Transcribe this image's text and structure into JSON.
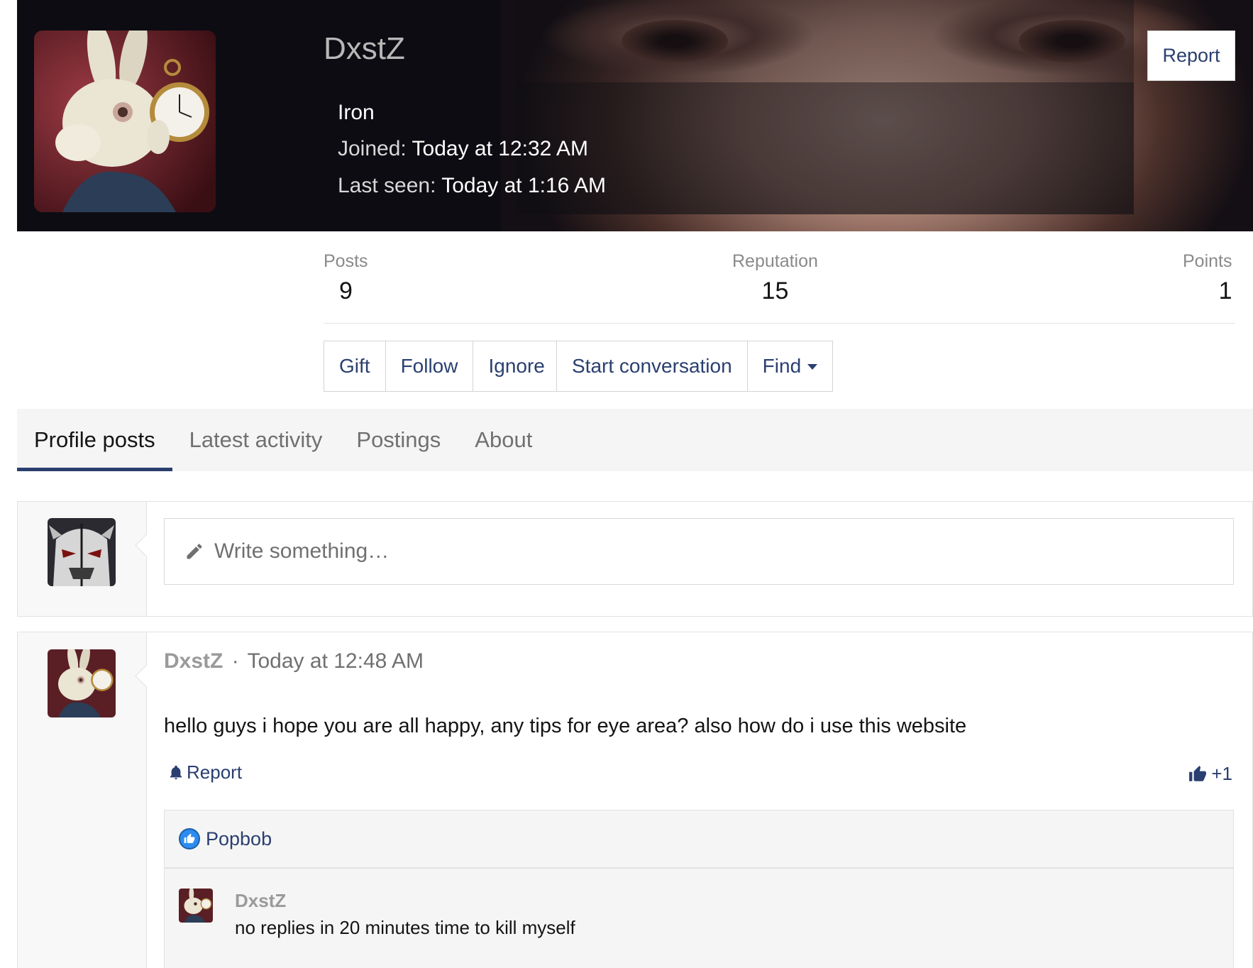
{
  "profile": {
    "username": "DxstZ",
    "user_title": "Iron",
    "joined_label": "Joined:",
    "joined_value": "Today at 12:32 AM",
    "last_seen_label": "Last seen:",
    "last_seen_value": "Today at 1:16 AM",
    "report_label": "Report"
  },
  "stats": {
    "posts_label": "Posts",
    "posts_value": "9",
    "reputation_label": "Reputation",
    "reputation_value": "15",
    "points_label": "Points",
    "points_value": "1"
  },
  "actions": {
    "gift": "Gift",
    "follow": "Follow",
    "ignore": "Ignore",
    "start_conversation": "Start conversation",
    "find": "Find"
  },
  "tabs": [
    {
      "label": "Profile posts",
      "active": true
    },
    {
      "label": "Latest activity",
      "active": false
    },
    {
      "label": "Postings",
      "active": false
    },
    {
      "label": "About",
      "active": false
    }
  ],
  "compose": {
    "placeholder": "Write something…"
  },
  "post": {
    "author": "DxstZ",
    "separator": "·",
    "time": "Today at 12:48 AM",
    "body": "hello guys i hope you are all happy, any tips for eye area? also how do i use this website",
    "report_label": "Report",
    "like_label": "+1",
    "reaction_user": "Popbob",
    "comment": {
      "author": "DxstZ",
      "body": "no replies in 20 minutes time to kill myself"
    }
  },
  "colors": {
    "link": "#2a3f70",
    "tab_active_underline": "#2a3f70",
    "reaction_like": "#2d8cf0"
  }
}
